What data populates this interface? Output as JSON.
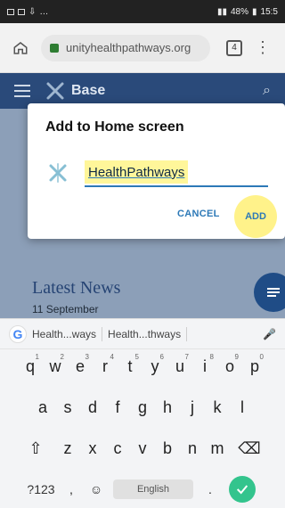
{
  "status_bar": {
    "left_icons": [
      "notification-icon",
      "image-icon",
      "download-icon",
      "more-icon"
    ],
    "right_text": "48%",
    "time": "15:5"
  },
  "browser": {
    "url": "unityhealthpathways.org",
    "tab_count": "4"
  },
  "site_header": {
    "title": "Base"
  },
  "dialog": {
    "title": "Add to Home screen",
    "name_value": "HealthPathways",
    "cancel_label": "CANCEL",
    "add_label": "ADD"
  },
  "page": {
    "latest_news": "Latest News",
    "date": "11 September"
  },
  "keyboard": {
    "suggestions": [
      "Health...ways",
      "Health...thways"
    ],
    "row1": [
      {
        "k": "q",
        "n": "1"
      },
      {
        "k": "w",
        "n": "2"
      },
      {
        "k": "e",
        "n": "3"
      },
      {
        "k": "r",
        "n": "4"
      },
      {
        "k": "t",
        "n": "5"
      },
      {
        "k": "y",
        "n": "6"
      },
      {
        "k": "u",
        "n": "7"
      },
      {
        "k": "i",
        "n": "8"
      },
      {
        "k": "o",
        "n": "9"
      },
      {
        "k": "p",
        "n": "0"
      }
    ],
    "row2": [
      "a",
      "s",
      "d",
      "f",
      "g",
      "h",
      "j",
      "k",
      "l"
    ],
    "row3": [
      "z",
      "x",
      "c",
      "v",
      "b",
      "n",
      "m"
    ],
    "bottom": {
      "mode": "?123",
      "comma": ",",
      "space": "English",
      "period": "."
    }
  },
  "colors": {
    "accent": "#2d79b7",
    "header": "#2a4a7a",
    "highlight": "#fff69a",
    "enter": "#33c48d"
  }
}
